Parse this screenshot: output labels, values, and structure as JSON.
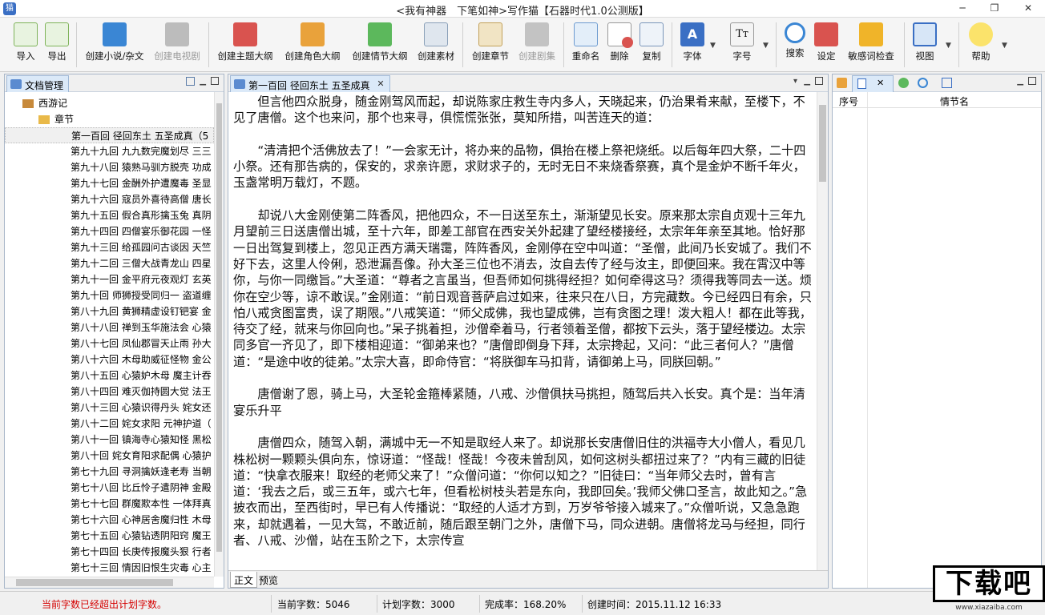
{
  "window": {
    "title": "<我有神器　下笔如神>写作猫【石器时代1.0公测版】",
    "min": "─",
    "max": "❐",
    "close": "✕"
  },
  "toolbar": {
    "import": "导入",
    "export": "导出",
    "create_novel": "创建小说/杂文",
    "create_tv": "创建电视剧",
    "create_theme": "创建主题大纲",
    "create_role": "创建角色大纲",
    "create_plot": "创建情节大纲",
    "create_material": "创建素材",
    "create_chapter": "创建章节",
    "create_scene": "创建剧集",
    "rename": "重命名",
    "delete": "删除",
    "copy": "复制",
    "font": "字体",
    "font_size": "字号",
    "search": "搜索",
    "settings": "设定",
    "sensitive": "敏感词检查",
    "view": "视图",
    "help": "帮助"
  },
  "left_panel": {
    "title": "文档管理",
    "book": "西游记",
    "folder": "章节",
    "chapters": [
      "第一百回 径回东土 五圣成真（5",
      "第九十九回 九九数完魔划尽 三三",
      "第九十八回 猿熟马驯方脱壳 功成",
      "第九十七回 金酬外护遭魔毒 圣显",
      "第九十六回 寇员外喜待高僧 唐长",
      "第九十五回 假合真形擒玉兔 真阴",
      "第九十四回 四僧宴乐御花园 一怪",
      "第九十三回 给孤园问古谈因 天竺",
      "第九十二回 三僧大战青龙山 四星",
      "第九十一回 金平府元夜观灯 玄英",
      "第九十回 师狮授受同归一 盗道缠",
      "第八十九回 黄狮精虚设钉钯宴 金",
      "第八十八回 禅到玉华施法会 心猿",
      "第八十七回 凤仙郡冒天止雨 孙大",
      "第八十六回 木母助威征怪物 金公",
      "第八十五回 心猿妒木母 魔主计吞",
      "第八十四回 难灭伽持圆大觉 法王",
      "第八十三回 心猿识得丹头 姹女还",
      "第八十二回 姹女求阳 元神护道（",
      "第八十一回 镇海寺心猿知怪 黑松",
      "第八十回 姹女育阳求配偶 心猿护",
      "第七十九回 寻洞擒妖逢老寿 当朝",
      "第七十八回 比丘怜子遣阴神 金殿",
      "第七十七回 群魔欺本性 一体拜真",
      "第七十六回 心神居舍魔归性 木母",
      "第七十五回 心猿钻透阴阳窍 魔王",
      "第七十四回 长庚传报魔头狠 行者",
      "第七十三回 情因旧恨生灾毒 心主"
    ]
  },
  "editor": {
    "tab": "第一百回 径回东土 五圣成真",
    "paragraphs": [
      "但言他四众脱身，随金刚驾风而起，却说陈家庄救生寺内多人，天晓起来，仍治果肴来献，至楼下，不见了唐僧。这个也来问，那个也来寻，俱慌慌张张，莫知所措，叫苦连天的道：",
      "“清清把个活佛放去了！”一会家无计，将办来的品物，俱抬在楼上祭祀烧纸。以后每年四大祭，二十四小祭。还有那告病的，保安的，求亲许愿，求财求子的，无时无日不来烧香祭赛，真个是金炉不断千年火，玉盏常明万载灯，不题。",
      "却说八大金刚使第二阵香风，把他四众，不一日送至东土，渐渐望见长安。原来那太宗自贞观十三年九月望前三日送唐僧出城，至十六年，即差工部官在西安关外起建了望经楼接经，太宗年年亲至其地。恰好那一日出驾复到楼上，忽见正西方满天瑞霭，阵阵香风，金刚停在空中叫道：“圣僧，此间乃长安城了。我们不好下去，这里人伶俐，恐泄漏吾像。孙大圣三位也不消去，汝自去传了经与汝主，即便回来。我在霄汉中等你，与你一同缴旨。”大圣道：“尊者之言虽当，但吾师如何挑得经担？如何牵得这马？须得我等同去一送。烦你在空少等，谅不敢误。”金刚道：“前日观音菩萨启过如来，往来只在八日，方完藏数。今已经四日有余，只怕八戒贪图富贵，误了期限。”八戒笑道：“师父成佛，我也望成佛，岂有贪图之理！泼大粗人！都在此等我，待交了经，就来与你回向也。”呆子挑着担，沙僧牵着马，行者领着圣僧，都按下云头，落于望经楼边。太宗同多官一齐见了，即下楼相迎道：“御弟来也？”唐僧即倒身下拜，太宗搀起，又问：“此三者何人？”唐僧道：“是途中收的徒弟。”太宗大喜，即命侍官：“将朕御车马扣背，请御弟上马，同朕回朝。”",
      "唐僧谢了恩，骑上马，大圣轮金箍棒紧随，八戒、沙僧俱扶马挑担，随驾后共入长安。真个是：当年清宴乐升平",
      "唐僧四众，随驾入朝，满城中无一不知是取经人来了。却说那长安唐僧旧住的洪福寺大小僧人，看见几株松树一颗颗头俱向东，惊讶道：“怪哉！怪哉！今夜未曾刮风，如何这树头都扭过来了？”内有三藏的旧徒道：“快拿衣服来！取经的老师父来了！”众僧问道：“你何以知之？”旧徒曰：“当年师父去时，曾有言道：‘我去之后，或三五年，或六七年，但看松树枝头若是东向，我即回矣。’我师父佛口圣言，故此知之。”急披衣而出，至西街时，早已有人传播说：“取经的人适才方到，万岁爷爷接入城来了。”众僧听说，又急急跑来，却就遇着，一见大驾，不敢近前，随后跟至朝门之外，唐僧下马，同众进朝。唐僧将龙马与经担，同行者、八戒、沙僧，站在玉阶之下，太宗传宣"
    ],
    "tab_body": "正文",
    "tab_preview": "预览"
  },
  "right_panel": {
    "col_index": "序号",
    "col_plot": "情节名"
  },
  "status": {
    "warning": "当前字数已经超出计划字数。",
    "current": "当前字数：5046",
    "plan": "计划字数：3000",
    "completion": "完成率：168.20%",
    "created": "创建时间：2015.11.12 16:33"
  },
  "watermark": {
    "brand": "下载吧",
    "url": "www.xiazaiba.com"
  },
  "colors": {
    "warning_text": "#d40000",
    "accent": "#3a6fc4"
  }
}
